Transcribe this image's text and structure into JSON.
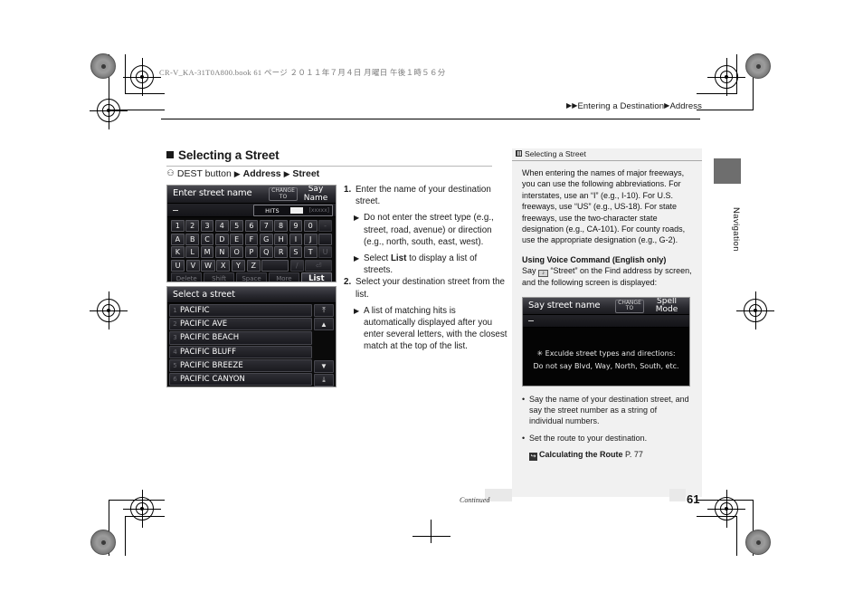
{
  "running_head": "CR-V_KA-31T0A800.book   61 ページ   ２０１１年７月４日   月曜日   午後１時５６分",
  "breadcrumb": {
    "tri1": "▶",
    "tri2": "▶",
    "item1": "Entering a Destination",
    "tri3": "▶",
    "item2": "Address"
  },
  "section": {
    "title": "Selecting a Street",
    "path": {
      "dest_glyph": "⚇",
      "dest_label": "DEST button",
      "tri1": "▶",
      "item1": "Address",
      "tri2": "▶",
      "item2": "Street"
    }
  },
  "keyboard_screen": {
    "title": "Enter street name",
    "change_to": "CHANGE TO",
    "say_name": "Say Name",
    "hits_label": "HITS",
    "hits_count": "[xxxxx]",
    "row1": [
      "1",
      "2",
      "3",
      "4",
      "5",
      "6",
      "7",
      "8",
      "9",
      "0",
      "-"
    ],
    "row2": [
      "A",
      "B",
      "C",
      "D",
      "E",
      "F",
      "G",
      "H",
      "I",
      "J"
    ],
    "row3": [
      "K",
      "L",
      "M",
      "N",
      "O",
      "P",
      "Q",
      "R",
      "S",
      "T",
      "U"
    ],
    "row4": [
      "U",
      "V",
      "W",
      "X",
      "Y",
      "Z"
    ],
    "row4_extra": [
      "",
      "/",
      "⏎"
    ],
    "func_keys": [
      "Delete",
      "Shift",
      "Space",
      "More",
      "List"
    ]
  },
  "list_screen": {
    "title": "Select a street",
    "items": [
      {
        "num": "1",
        "name": "PACIFIC"
      },
      {
        "num": "2",
        "name": "PACIFIC AVE"
      },
      {
        "num": "3",
        "name": "PACIFIC BEACH"
      },
      {
        "num": "4",
        "name": "PACIFIC BLUFF"
      },
      {
        "num": "5",
        "name": "PACIFIC BREEZE"
      },
      {
        "num": "6",
        "name": "PACIFIC CANYON"
      }
    ],
    "scroll": {
      "top": "⤒",
      "up": "▲",
      "down": "▼",
      "bottom": "⤓"
    }
  },
  "steps": [
    {
      "num": "1.",
      "text": "Enter the name of your destination street.",
      "subs": [
        {
          "tri": "▶",
          "pre": "Do not enter the street type (e.g., street, road, avenue) or direction (e.g., north, south, east, west).",
          "bold": "",
          "post": ""
        },
        {
          "tri": "▶",
          "pre": "Select ",
          "bold": "List",
          "post": " to display a list of streets."
        }
      ]
    },
    {
      "num": "2.",
      "text": "Select your destination street from the list.",
      "subs": [
        {
          "tri": "▶",
          "pre": "A list of matching hits is automatically displayed after you enter several letters, with the closest match at the top of the list.",
          "bold": "",
          "post": ""
        }
      ]
    }
  ],
  "sidebar": {
    "head": "Selecting a Street",
    "paragraph1": "When entering the names of major freeways, you can use the following abbreviations. For interstates, use an “I” (e.g., I-10). For U.S. freeways, use “US” (e.g., US-18). For state freeways, use the two-character state designation (e.g., CA-101). For county roads, use the appropriate designation (e.g., G-2).",
    "subhead": "Using Voice Command (English only)",
    "say_pre": "Say ",
    "mic_glyph": "♪",
    "say_post": " “Street” on the Find address by screen, and the following screen is displayed:",
    "voice_screen": {
      "title": "Say street name",
      "change_to": "CHANGE TO",
      "spell_mode": "Spell Mode",
      "line1": "✳ Exculde street types and directions:",
      "line2": "Do not say Blvd, Way, North, South, etc."
    },
    "bullets": [
      {
        "dot": "•",
        "text": "Say the name of your destination street, and say the street number as a string of individual numbers."
      },
      {
        "dot": "•",
        "text": "Set the route to your destination."
      }
    ],
    "reference": {
      "icon": "↪",
      "label": "Calculating the Route",
      "page": "P. 77"
    }
  },
  "edge_tab": {
    "label": "Navigation"
  },
  "footer": {
    "continued": "Continued",
    "page_number": "61"
  }
}
